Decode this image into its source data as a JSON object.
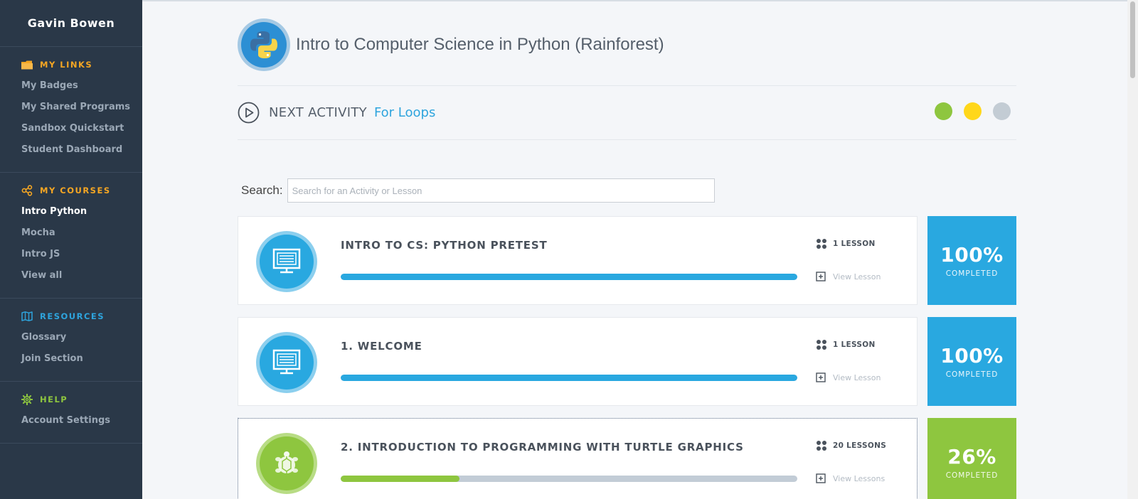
{
  "sidebar": {
    "user_name": "Gavin Bowen",
    "my_links": {
      "heading": "MY LINKS",
      "items": [
        "My Badges",
        "My Shared Programs",
        "Sandbox Quickstart",
        "Student Dashboard"
      ]
    },
    "my_courses": {
      "heading": "MY COURSES",
      "items": [
        "Intro Python",
        "Mocha",
        "Intro JS",
        "View all"
      ],
      "active": "Intro Python"
    },
    "resources": {
      "heading": "RESOURCES",
      "items": [
        "Glossary",
        "Join Section"
      ]
    },
    "help": {
      "heading": "HELP",
      "items": [
        "Account Settings"
      ]
    }
  },
  "course": {
    "title": "Intro to Computer Science in Python (Rainforest)",
    "next_activity_label": "NEXT ACTIVITY",
    "next_activity_name": "For Loops",
    "status_colors": [
      "#8ec63f",
      "#ffd71a",
      "#c3ccd4"
    ]
  },
  "search": {
    "label": "Search:",
    "placeholder": "Search for an Activity or Lesson",
    "value": ""
  },
  "units": [
    {
      "title": "INTRO TO CS: PYTHON PRETEST",
      "lessons": "1 LESSON",
      "view_label": "View Lesson",
      "progress": 1.0,
      "percent": "100%",
      "completed_label": "COMPLETED",
      "icon": "computer-icon",
      "color": "#29a8e0"
    },
    {
      "title": "1. WELCOME",
      "lessons": "1 LESSON",
      "view_label": "View Lesson",
      "progress": 1.0,
      "percent": "100%",
      "completed_label": "COMPLETED",
      "icon": "computer-icon",
      "color": "#29a8e0"
    },
    {
      "title": "2. INTRODUCTION TO PROGRAMMING WITH TURTLE GRAPHICS",
      "lessons": "20 LESSONS",
      "view_label": "View Lessons",
      "progress": 0.26,
      "percent": "26%",
      "completed_label": "COMPLETED",
      "icon": "turtle-icon",
      "color": "#8ec63f"
    }
  ]
}
